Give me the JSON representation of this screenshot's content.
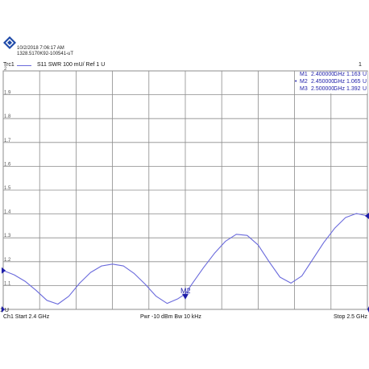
{
  "header": {
    "datetime": "10/2/2018 7:06:17 AM",
    "instrument_id": "1328.5170K92-100541-uT",
    "trace_label": "Trc1",
    "trace_desc": "S11  SWR  100 mU/  Ref 1 U",
    "channel_index": "1"
  },
  "footer": {
    "start": "Ch1  Start  2.4 GHz",
    "power": "Pwr  -10 dBm  Bw  10 kHz",
    "stop": "Stop  2.5 GHz"
  },
  "markers_table": [
    {
      "prefix": "",
      "name": "M1",
      "freq": "2.400000",
      "freq_unit": "GHz",
      "value": "1.163",
      "value_unit": "U"
    },
    {
      "prefix": "•",
      "name": "M2",
      "freq": "2.450000",
      "freq_unit": "GHz",
      "value": "1.065",
      "value_unit": "U"
    },
    {
      "prefix": "",
      "name": "M3",
      "freq": "2.500000",
      "freq_unit": "GHz",
      "value": "1.392",
      "value_unit": "U"
    }
  ],
  "colors": {
    "trace": "#6a6adc",
    "marker": "#1c1ca8",
    "grid": "#8c8c8c"
  },
  "chart_data": {
    "type": "line",
    "title": "",
    "xlabel": "",
    "ylabel": "",
    "xlim": [
      2.4,
      2.5
    ],
    "ylim": [
      1.0,
      2.0
    ],
    "grid": true,
    "y_ticks": [
      {
        "v": 2.0,
        "label": "2"
      },
      {
        "v": 1.9,
        "label": "1.9"
      },
      {
        "v": 1.8,
        "label": "1.8"
      },
      {
        "v": 1.7,
        "label": "1.7"
      },
      {
        "v": 1.6,
        "label": "1.6"
      },
      {
        "v": 1.5,
        "label": "1.5"
      },
      {
        "v": 1.4,
        "label": "1.4"
      },
      {
        "v": 1.3,
        "label": "1.3"
      },
      {
        "v": 1.2,
        "label": "1.2"
      },
      {
        "v": 1.1,
        "label": "1.1"
      },
      {
        "v": 1.0,
        "label": "1 U"
      }
    ],
    "series": [
      {
        "x": [
          2.4,
          2.403,
          2.406,
          2.409,
          2.412,
          2.415,
          2.418,
          2.421,
          2.424,
          2.427,
          2.43,
          2.433,
          2.436,
          2.439,
          2.442,
          2.445,
          2.448,
          2.45,
          2.452,
          2.455,
          2.458,
          2.461,
          2.464,
          2.467,
          2.47,
          2.473,
          2.476,
          2.479,
          2.482,
          2.485,
          2.488,
          2.491,
          2.494,
          2.497,
          2.5
        ],
        "y": [
          1.163,
          1.145,
          1.118,
          1.08,
          1.038,
          1.022,
          1.055,
          1.11,
          1.155,
          1.182,
          1.19,
          1.182,
          1.15,
          1.105,
          1.055,
          1.025,
          1.045,
          1.065,
          1.11,
          1.175,
          1.235,
          1.285,
          1.315,
          1.31,
          1.27,
          1.2,
          1.135,
          1.11,
          1.14,
          1.21,
          1.28,
          1.34,
          1.385,
          1.402,
          1.392
        ]
      }
    ],
    "markers": [
      {
        "name": "M1",
        "x": 2.4,
        "y": 1.163
      },
      {
        "name": "M2",
        "x": 2.45,
        "y": 1.065
      },
      {
        "name": "M3",
        "x": 2.5,
        "y": 1.392
      }
    ],
    "ref_level": 1.0
  }
}
